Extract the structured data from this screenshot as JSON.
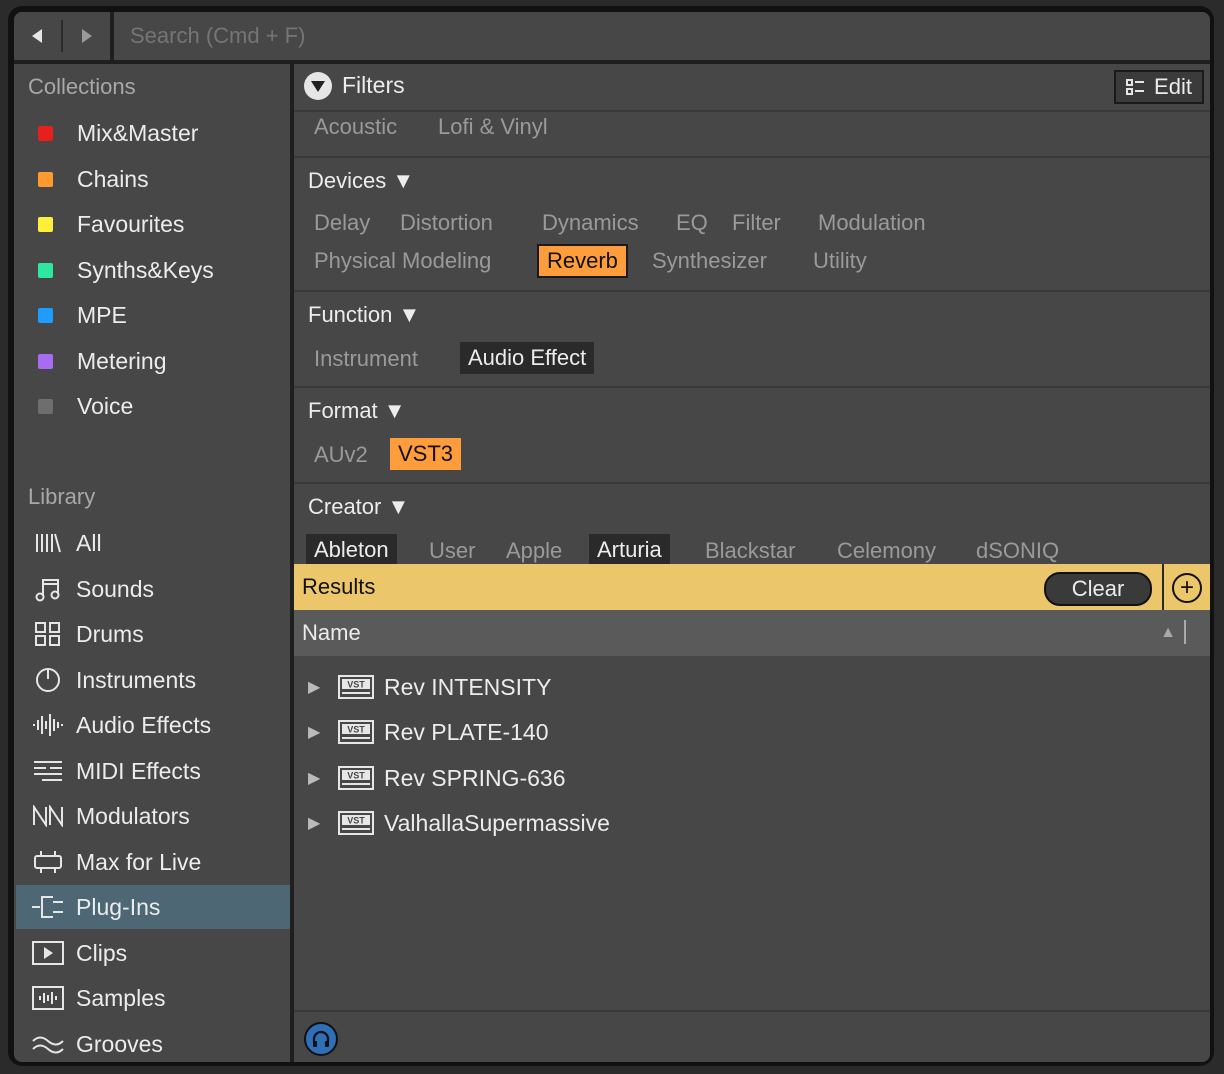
{
  "nav": {
    "back_icon": "arrow-left-icon",
    "forward_icon": "arrow-right-icon"
  },
  "search": {
    "placeholder": "Search (Cmd + F)"
  },
  "collections": {
    "title": "Collections",
    "items": [
      {
        "label": "Mix&Master",
        "color": "#e8201c"
      },
      {
        "label": "Chains",
        "color": "#ff9b2e"
      },
      {
        "label": "Favourites",
        "color": "#ffee3a"
      },
      {
        "label": "Synths&Keys",
        "color": "#2ee8a0"
      },
      {
        "label": "MPE",
        "color": "#1f9cff"
      },
      {
        "label": "Metering",
        "color": "#a86cf2"
      },
      {
        "label": "Voice",
        "color": "#6e6e6e"
      }
    ]
  },
  "library": {
    "title": "Library",
    "items": [
      {
        "label": "All",
        "icon": "all-icon"
      },
      {
        "label": "Sounds",
        "icon": "music-note-icon"
      },
      {
        "label": "Drums",
        "icon": "drum-pads-icon"
      },
      {
        "label": "Instruments",
        "icon": "instrument-knob-icon"
      },
      {
        "label": "Audio Effects",
        "icon": "waveform-icon"
      },
      {
        "label": "MIDI Effects",
        "icon": "midi-icon"
      },
      {
        "label": "Modulators",
        "icon": "modulator-icon"
      },
      {
        "label": "Max for Live",
        "icon": "max-icon"
      },
      {
        "label": "Plug-Ins",
        "icon": "plug-icon",
        "selected": true
      },
      {
        "label": "Clips",
        "icon": "clip-icon"
      },
      {
        "label": "Samples",
        "icon": "sample-icon"
      },
      {
        "label": "Grooves",
        "icon": "groove-icon"
      }
    ]
  },
  "filters": {
    "title": "Filters",
    "edit_label": "Edit",
    "top_tags": [
      "Acoustic",
      "Lofi & Vinyl"
    ],
    "devices": {
      "title": "Devices ▼",
      "tags": [
        "Delay",
        "Distortion",
        "Dynamics",
        "EQ",
        "Filter",
        "Modulation",
        "Physical Modeling",
        "Reverb",
        "Synthesizer",
        "Utility"
      ],
      "selected": "Reverb"
    },
    "function": {
      "title": "Function ▼",
      "tags": [
        "Instrument",
        "Audio Effect"
      ],
      "selected": "Audio Effect"
    },
    "format": {
      "title": "Format ▼",
      "tags": [
        "AUv2",
        "VST3"
      ],
      "selected": "VST3"
    },
    "creator": {
      "title": "Creator ▼",
      "tags": [
        "Ableton",
        "User",
        "Apple",
        "Arturia",
        "Blackstar",
        "Celemony",
        "dSONIQ"
      ],
      "selected": [
        "Ableton",
        "Arturia"
      ]
    }
  },
  "results": {
    "title": "Results",
    "clear_label": "Clear",
    "plus_label": "+",
    "column_name": "Name",
    "sort": "ascending",
    "items": [
      {
        "name": "Rev INTENSITY",
        "icon": "vst-icon"
      },
      {
        "name": "Rev PLATE-140",
        "icon": "vst-icon"
      },
      {
        "name": "Rev SPRING-636",
        "icon": "vst-icon"
      },
      {
        "name": "ValhallaSupermassive",
        "icon": "vst-icon"
      }
    ]
  },
  "colors": {
    "accent_orange": "#ff9c3b",
    "results_bar": "#ecc66a",
    "selected_row": "#4d6874"
  }
}
